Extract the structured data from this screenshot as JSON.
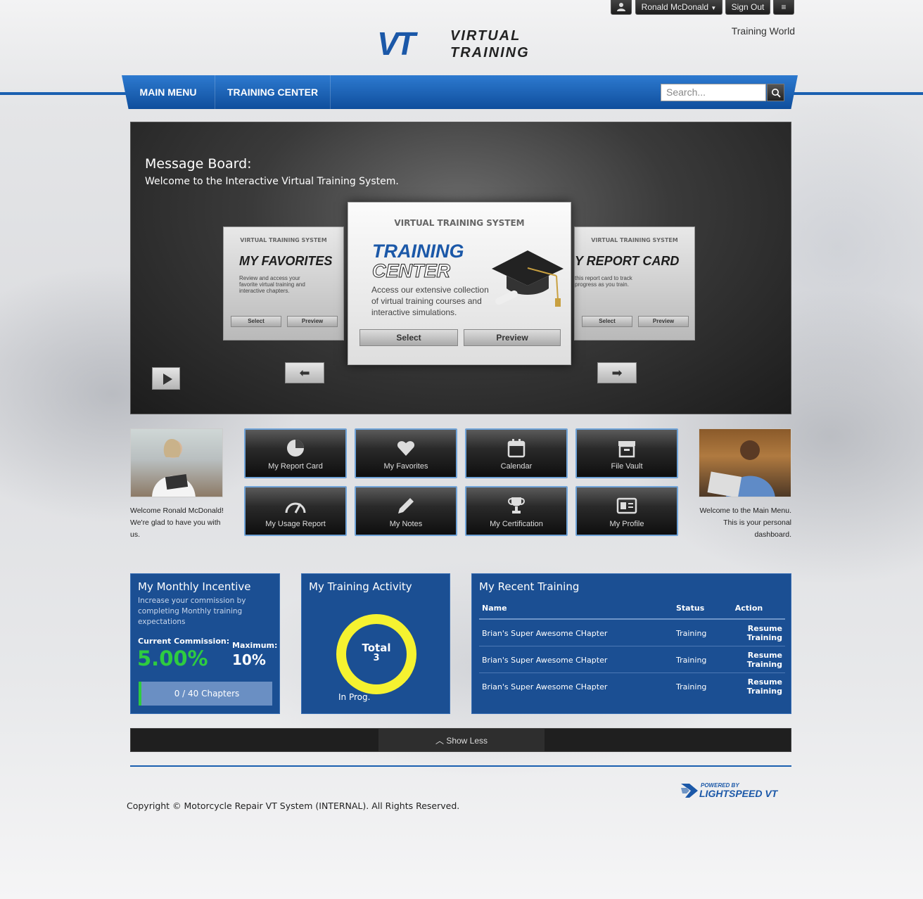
{
  "topbar": {
    "user_name": "Ronald McDonald",
    "sign_out": "Sign Out",
    "world": "Training World"
  },
  "logo": {
    "vt": "VT",
    "line1": "VIRTUAL",
    "line2": "TRAINING"
  },
  "nav": {
    "items": [
      "MAIN MENU",
      "TRAINING CENTER"
    ],
    "search_placeholder": "Search..."
  },
  "message_board": {
    "title": "Message Board:",
    "text": "Welcome to the Interactive Virtual Training System."
  },
  "carousel": {
    "left_card": {
      "system": "VIRTUAL TRAINING SYSTEM",
      "title": "MY FAVORITES",
      "desc": "Review and access your favorite virtual training and interactive chapters.",
      "select": "Select",
      "preview": "Preview"
    },
    "main_card": {
      "system": "VIRTUAL TRAINING SYSTEM",
      "title1": "TRAINING",
      "title2": "CENTER",
      "desc": "Access our extensive collection of virtual training courses and interactive simulations.",
      "select": "Select",
      "preview": "Preview"
    },
    "right_card": {
      "system": "VIRTUAL TRAINING SYSTEM",
      "title": "Y REPORT CARD",
      "desc": "this report card to track progress as you train.",
      "select": "Select",
      "preview": "Preview"
    }
  },
  "welcome_left": {
    "line1": "Welcome Ronald McDonald!",
    "line2": "We're glad to have you with us."
  },
  "welcome_right": "Welcome to the Main Menu. This is your personal dashboard.",
  "tiles": [
    {
      "label": "My Report Card",
      "icon": "pie-chart-icon"
    },
    {
      "label": "My Favorites",
      "icon": "heart-icon"
    },
    {
      "label": "Calendar",
      "icon": "calendar-icon"
    },
    {
      "label": "File Vault",
      "icon": "archive-icon"
    },
    {
      "label": "My Usage Report",
      "icon": "gauge-icon"
    },
    {
      "label": "My Notes",
      "icon": "pencil-icon"
    },
    {
      "label": "My Certification",
      "icon": "trophy-icon"
    },
    {
      "label": "My Profile",
      "icon": "id-card-icon"
    }
  ],
  "incentive": {
    "title": "My Monthly Incentive",
    "desc": "Increase your commission by completing Monthly training expectations",
    "current_label": "Current Commission:",
    "current_value": "5.00%",
    "max_label": "Maximum:",
    "max_value": "10%",
    "progress_text": "0 / 40 Chapters",
    "progress": 0
  },
  "activity": {
    "title": "My Training Activity",
    "total_label": "Total",
    "total_value": "3",
    "legend": "In Prog."
  },
  "recent": {
    "title": "My Recent Training",
    "columns": [
      "Name",
      "Status",
      "Action"
    ],
    "rows": [
      {
        "name": "Brian's Super Awesome CHapter",
        "status": "Training",
        "action": "Resume Training"
      },
      {
        "name": "Brian's Super Awesome CHapter",
        "status": "Training",
        "action": "Resume Training"
      },
      {
        "name": "Brian's Super Awesome CHapter",
        "status": "Training",
        "action": "Resume Training"
      }
    ]
  },
  "show_less": "Show Less",
  "copyright": "Copyright © Motorcycle Repair VT System (INTERNAL). All Rights Reserved.",
  "powered": {
    "line1": "POWERED BY",
    "line2": "LIGHTSPEED VT"
  },
  "colors": {
    "brand_blue": "#1b4f93",
    "accent_green": "#2ecc40",
    "donut_yellow": "#f5f230"
  }
}
